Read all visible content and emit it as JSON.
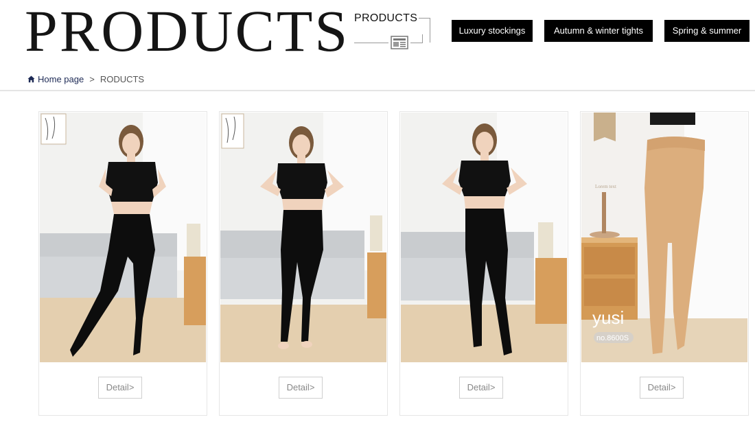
{
  "header": {
    "big_title": "PRODUCTS",
    "sub_title": "PRODUCTS"
  },
  "nav": {
    "items": [
      {
        "label": "Luxury stockings"
      },
      {
        "label": "Autumn & winter tights"
      },
      {
        "label": "Spring & summer"
      }
    ]
  },
  "breadcrumb": {
    "home_label": "Home page",
    "separator": ">",
    "current": "RODUCTS"
  },
  "products": [
    {
      "detail_label": "Detail>",
      "photo": "model-black-tights-lace-top"
    },
    {
      "detail_label": "Detail>",
      "photo": "model-black-leggings-barefoot"
    },
    {
      "detail_label": "Detail>",
      "photo": "model-black-tights-hands-hips"
    },
    {
      "detail_label": "Detail>",
      "photo": "beige-tights-legs",
      "brand_label": "yusi",
      "model_label": "no.8600S"
    }
  ],
  "colors": {
    "nav_bg": "#000000",
    "nav_text": "#ffffff",
    "breadcrumb_link": "#1d2a55"
  }
}
